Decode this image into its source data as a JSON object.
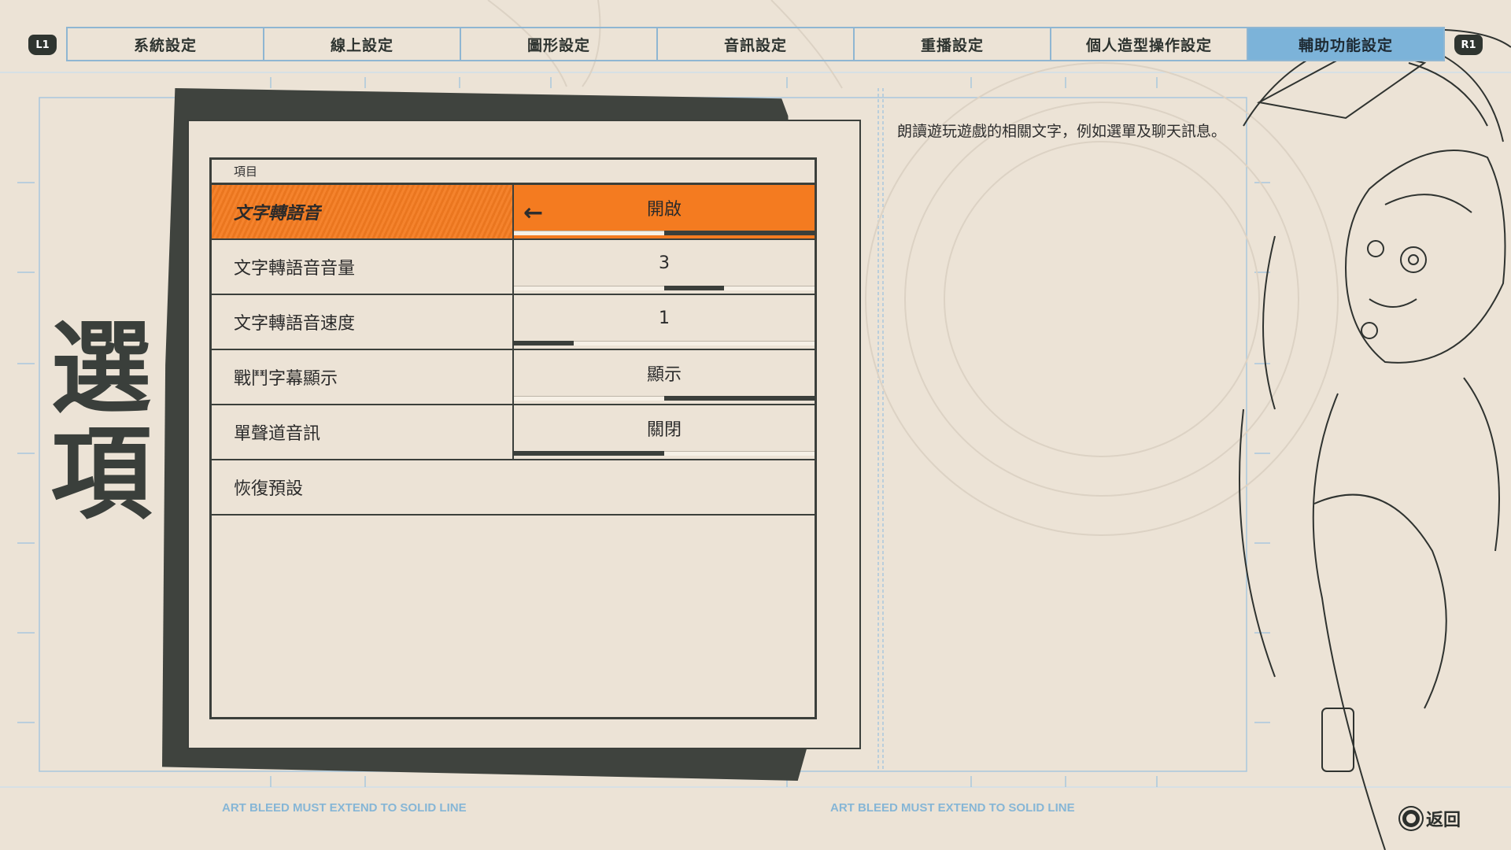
{
  "controls": {
    "left_shoulder": "L1",
    "right_shoulder": "R1"
  },
  "tabs": [
    {
      "label": "系統設定"
    },
    {
      "label": "線上設定"
    },
    {
      "label": "圖形設定"
    },
    {
      "label": "音訊設定"
    },
    {
      "label": "重播設定"
    },
    {
      "label": "個人造型操作設定"
    },
    {
      "label": "輔助功能設定"
    }
  ],
  "active_tab": "輔助功能設定",
  "page_title": "選項",
  "options_table": {
    "header": "項目",
    "rows": [
      {
        "label": "文字轉語音",
        "value": "開啟",
        "level": 1.0,
        "selected": true
      },
      {
        "label": "文字轉語音音量",
        "value": "3",
        "level": 0.6
      },
      {
        "label": "文字轉語音速度",
        "value": "1",
        "level": 0.2
      },
      {
        "label": "戰鬥字幕顯示",
        "value": "顯示",
        "level": 1.0
      },
      {
        "label": "單聲道音訊",
        "value": "關閉",
        "level": 0.5
      }
    ],
    "reset_label": "恢復預設"
  },
  "description": "朗讀遊玩遊戲的相關文字，例如選單及聊天訊息。",
  "footer": {
    "bleed_note_left": "ART BLEED MUST EXTEND TO SOLID LINE",
    "bleed_note_right": "ART BLEED MUST EXTEND TO SOLID LINE",
    "back_label": "返回"
  },
  "colors": {
    "background": "#ece3d6",
    "accent_orange": "#f47b20",
    "active_tab_blue": "#7cb3d9",
    "guide_blue": "#8fb6d2",
    "ink": "#3b3f3b"
  }
}
